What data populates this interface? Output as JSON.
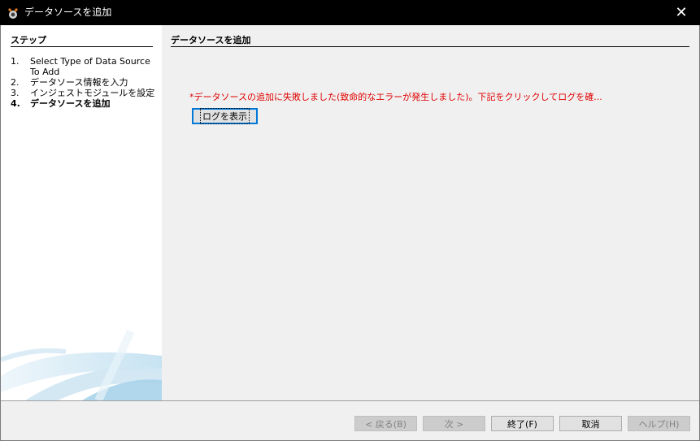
{
  "window": {
    "title": "データソースを追加",
    "app_icon": "netbeans-app-icon",
    "close_glyph": "✕"
  },
  "steps": {
    "heading": "ステップ",
    "items": [
      {
        "num": "1.",
        "label": "Select Type of Data Source To Add",
        "current": false
      },
      {
        "num": "2.",
        "label": "データソース情報を入力",
        "current": false
      },
      {
        "num": "3.",
        "label": "インジェストモジュールを設定",
        "current": false
      },
      {
        "num": "4.",
        "label": "データソースを追加",
        "current": true
      }
    ]
  },
  "main": {
    "heading": "データソースを追加",
    "error_message": "*データソースの追加に失敗しました(致命的なエラーが発生しました)。下記をクリックしてログを確...",
    "view_log_button": "ログを表示"
  },
  "buttons": {
    "back": "< 戻る(B)",
    "next": "次 >",
    "finish": "終了(F)",
    "cancel": "取消",
    "help": "ヘルプ(H)"
  },
  "colors": {
    "error_text": "#e00000",
    "title_bar": "#000000",
    "focus_border": "#0078d7"
  }
}
